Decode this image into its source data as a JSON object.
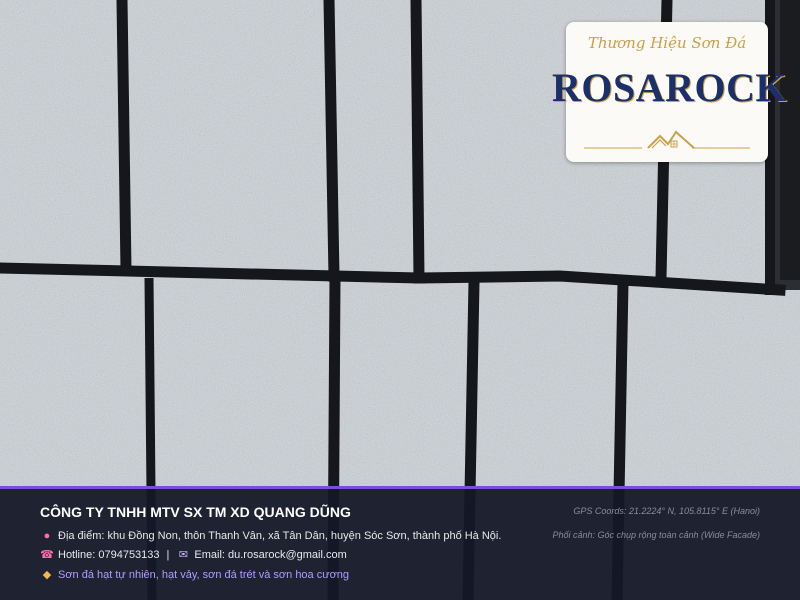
{
  "brand": {
    "tagline": "Thương Hiệu Sơn Đá",
    "name": "ROSAROCK"
  },
  "info": {
    "company": "CÔNG TY TNHH MTV SX TM XD QUANG DŨNG",
    "gps": "GPS Coords: 21.2224° N, 105.8115° E (Hanoi)",
    "address": "Địa điểm: khu Đồng Non, thôn Thanh Vân, xã Tân Dân, huyện Sóc Sơn, thành phố Hà Nội.",
    "scene": "Phối cảnh: Góc chụp rộng toàn cảnh (Wide Facade)",
    "hotline": "Hotline: 0794753133",
    "separator": "|",
    "email": "Email: du.rosarock@gmail.com",
    "products": "Sơn đá hạt tự nhiên, hạt vảy, sơn đá trét và sơn hoa cương"
  },
  "icons": {
    "address": "map-pin-icon",
    "hotline": "phone-icon",
    "email": "envelope-icon",
    "products": "tag-icon"
  },
  "colors": {
    "accent": "#7c4ddd",
    "brand_navy": "#1b2f6b",
    "brand_gold": "#c9a14a"
  }
}
